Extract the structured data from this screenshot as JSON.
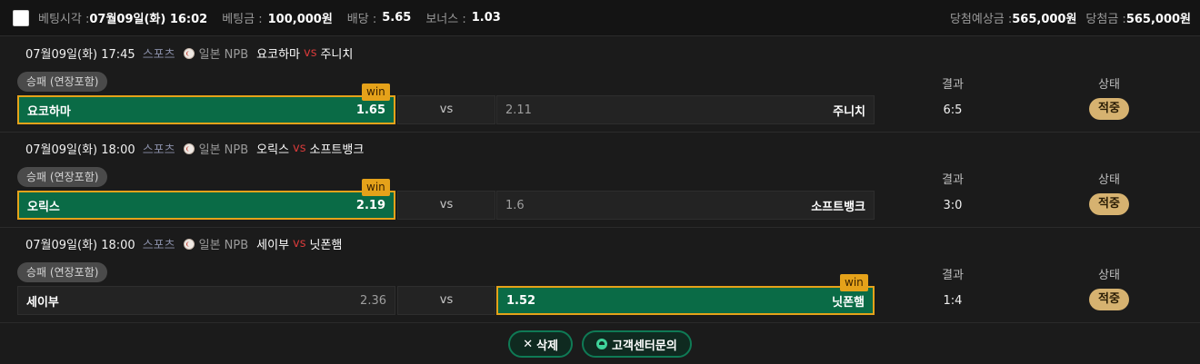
{
  "summary": {
    "bet_time_label": "베팅시각 :",
    "bet_time": "07월09일(화) 16:02",
    "bet_amount_label": "베팅금 :",
    "bet_amount": "100,000원",
    "odds_label": "배당 :",
    "odds": "5.65",
    "bonus_label": "보너스 :",
    "bonus": "1.03",
    "expected_win_label": "당첨예상금 :",
    "expected_win": "565,000원",
    "win_amount_label": "당첨금 :",
    "win_amount": "565,000원"
  },
  "matches": [
    {
      "date": "07월09일(화) 17:45",
      "sport": "스포츠",
      "league": "일본 NPB",
      "home": "요코하마",
      "vs": "vs",
      "away": "주니치",
      "market": "승패 (연장포함)",
      "home_odds": "1.65",
      "middle": "vs",
      "away_odds": "2.11",
      "win_tag": "win",
      "result_label": "결과",
      "status_label": "상태",
      "score": "6:5",
      "status": "적중"
    },
    {
      "date": "07월09일(화) 18:00",
      "sport": "스포츠",
      "league": "일본 NPB",
      "home": "오릭스",
      "vs": "vs",
      "away": "소프트뱅크",
      "market": "승패 (연장포함)",
      "home_odds": "2.19",
      "middle": "vs",
      "away_odds": "1.6",
      "win_tag": "win",
      "result_label": "결과",
      "status_label": "상태",
      "score": "3:0",
      "status": "적중"
    },
    {
      "date": "07월09일(화) 18:00",
      "sport": "스포츠",
      "league": "일본 NPB",
      "home": "세이부",
      "vs": "vs",
      "away": "닛폰햄",
      "market": "승패 (연장포함)",
      "home_odds": "2.36",
      "middle": "vs",
      "away_odds": "1.52",
      "win_tag": "win",
      "result_label": "결과",
      "status_label": "상태",
      "score": "1:4",
      "status": "적중"
    }
  ],
  "footer": {
    "delete_icon": "✕",
    "delete_label": "삭제",
    "support_label": "고객센터문의"
  },
  "colors": {
    "selected_bg": "#0a6b46",
    "selected_border": "#e5a21a",
    "status_bg": "#d6b270",
    "vs_red": "#d63a3a"
  }
}
